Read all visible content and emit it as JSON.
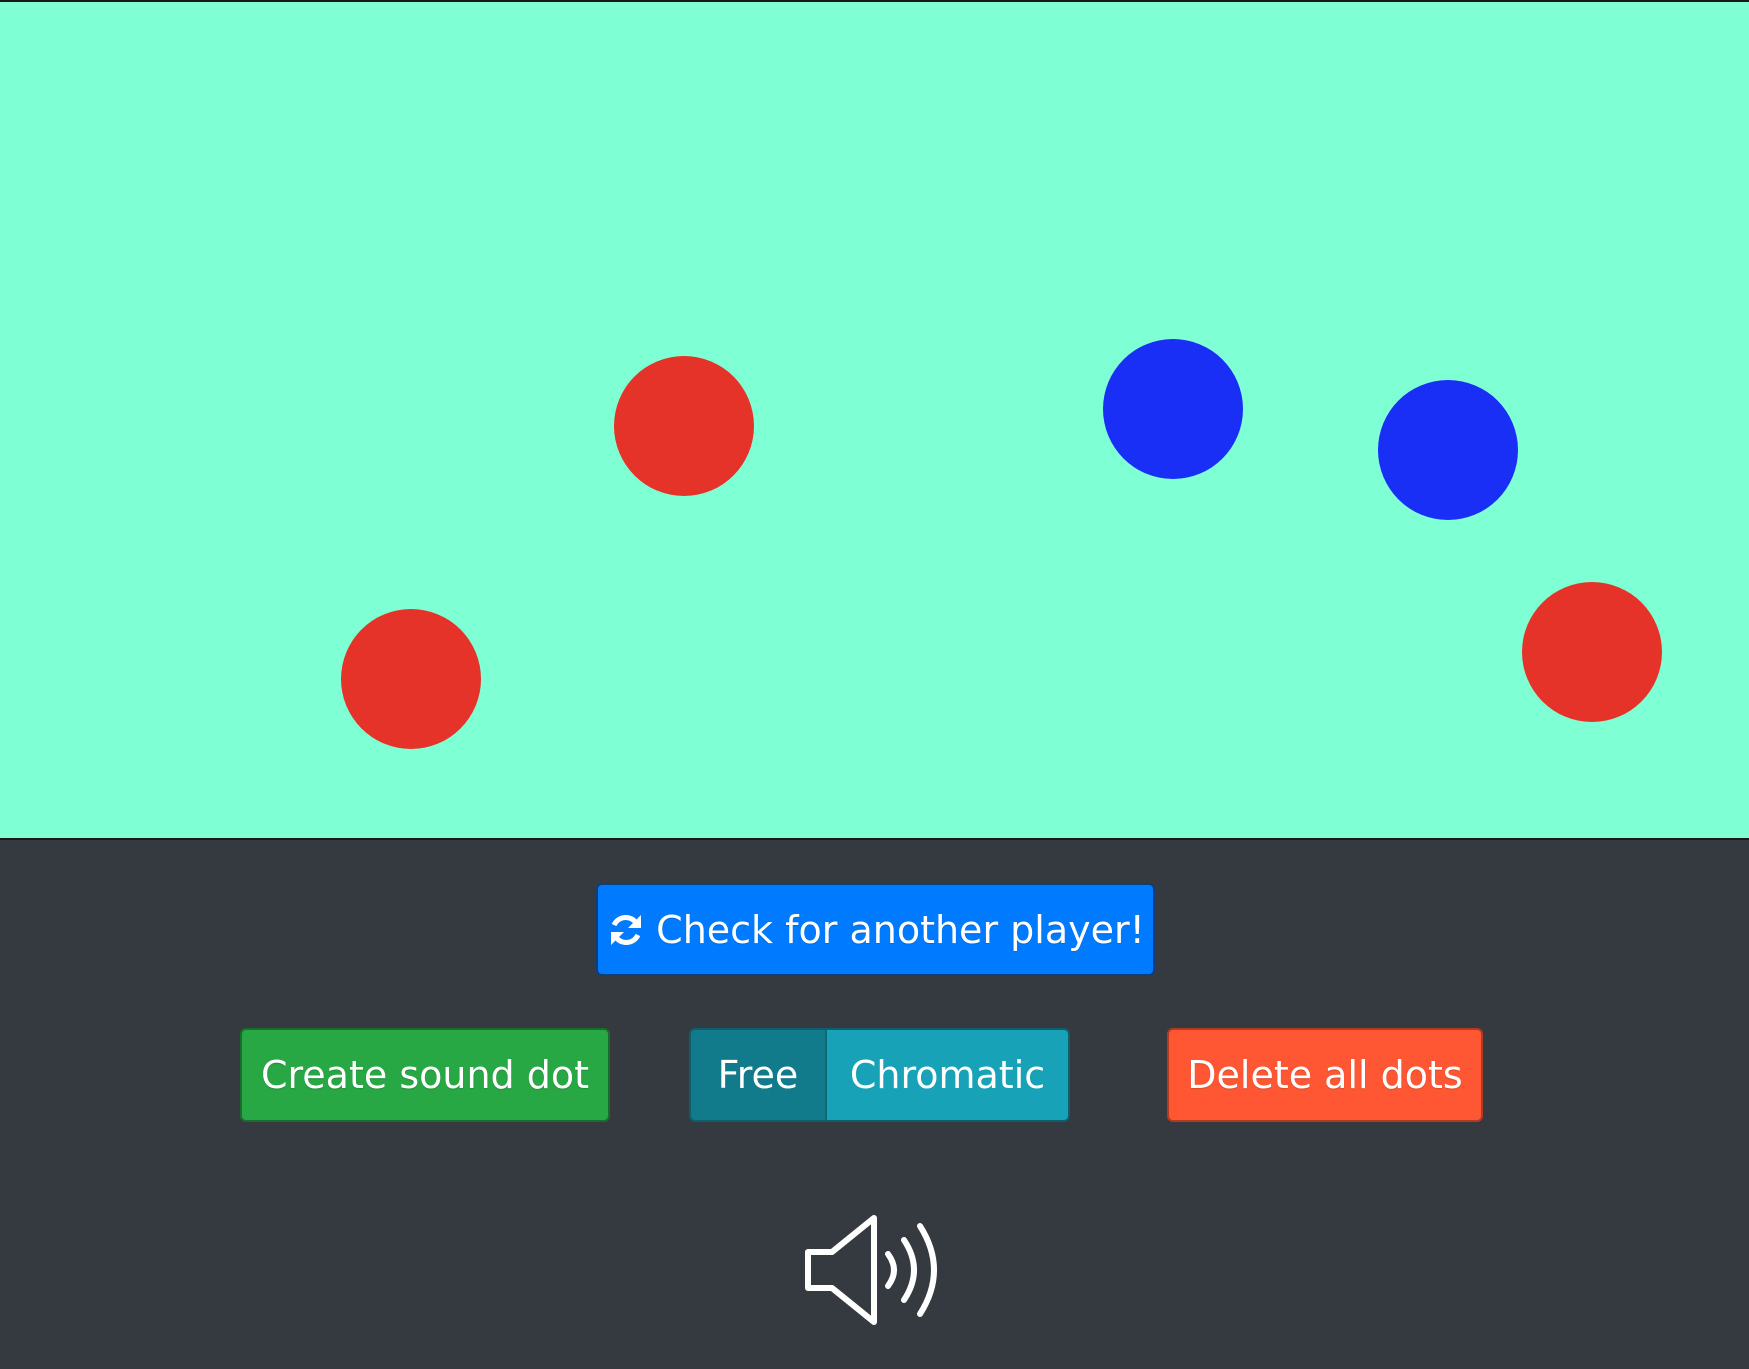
{
  "stage": {
    "background": "#7fffd4",
    "dots": [
      {
        "color": "#e63329"
      },
      {
        "color": "#e63329"
      },
      {
        "color": "#1a2ff5"
      },
      {
        "color": "#1a2ff5"
      },
      {
        "color": "#e63329"
      }
    ]
  },
  "controls": {
    "check_player_label": "Check for another player!",
    "check_player_icon": "refresh-icon",
    "create_dot_label": "Create sound dot",
    "mode_toggle": {
      "options": [
        "Free",
        "Chromatic"
      ],
      "selected": "Free"
    },
    "delete_dots_label": "Delete all dots",
    "volume_icon": "speaker-volume-icon"
  },
  "colors": {
    "primary": "#007bff",
    "success": "#28a745",
    "info": "#17a2b8",
    "info_active": "#117a8b",
    "danger": "#ff5733",
    "panel": "#343a40"
  }
}
